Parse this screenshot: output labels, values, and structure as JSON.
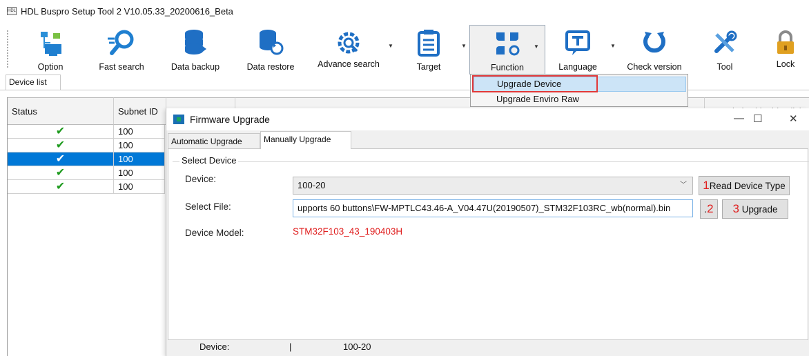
{
  "window": {
    "title": "HDL Buspro Setup Tool 2 V10.05.33_20200616_Beta",
    "app_icon_text": "HDL"
  },
  "toolbar": {
    "buttons": [
      {
        "label": "Option",
        "icon": "option-icon"
      },
      {
        "label": "Fast search",
        "icon": "fast-search-icon"
      },
      {
        "label": "Data backup",
        "icon": "data-backup-icon"
      },
      {
        "label": "Data restore",
        "icon": "data-restore-icon"
      },
      {
        "label": "Advance search",
        "icon": "advance-search-icon"
      },
      {
        "label": "Target",
        "icon": "target-icon"
      },
      {
        "label": "Function",
        "icon": "function-icon"
      },
      {
        "label": "Language",
        "icon": "language-icon"
      },
      {
        "label": "Check version",
        "icon": "check-version-icon"
      },
      {
        "label": "Tool",
        "icon": "tool-icon"
      },
      {
        "label": "Lock",
        "icon": "lock-icon"
      }
    ]
  },
  "device_list": {
    "tab_label": "Device list",
    "columns": [
      "Status",
      "Subnet ID",
      "Description(double click"
    ],
    "rows": [
      {
        "status": "✔",
        "subnet": "100",
        "selected": false
      },
      {
        "status": "✔",
        "subnet": "100",
        "selected": false
      },
      {
        "status": "✔",
        "subnet": "100",
        "selected": true
      },
      {
        "status": "✔",
        "subnet": "100",
        "selected": false
      },
      {
        "status": "✔",
        "subnet": "100",
        "selected": false
      }
    ]
  },
  "function_menu": {
    "items": [
      "Upgrade Device",
      "Upgrade Enviro Raw"
    ]
  },
  "dialog": {
    "title": "Firmware Upgrade",
    "window_controls": [
      "—",
      "☐",
      "✕"
    ],
    "tabs": [
      "Automatic Upgrade",
      "Manually Upgrade"
    ],
    "group_label": "Select Device",
    "device_label": "Device:",
    "device_value": "100-20",
    "file_label": "Select File:",
    "file_value": "upports 60 buttons\\FW-MPTLC43.46-A_V04.47U(20190507)_STM32F103RC_wb(normal).bin",
    "model_label": "Device Model:",
    "model_value": "STM32F103_43_190403H",
    "read_button": {
      "mark": "1",
      "label": "Read Device Type"
    },
    "browse_button": {
      "label": ".",
      "mark": "2"
    },
    "upgrade_button": {
      "mark": "3",
      "label": "Upgrade"
    },
    "status_device_label": "Device:",
    "status_sep": "|",
    "status_device_value": "100-20"
  },
  "colors": {
    "selection": "#0078d7",
    "check": "#1e9b1e",
    "annotation_red": "#e02020",
    "menu_highlight": "#cce4f7"
  }
}
